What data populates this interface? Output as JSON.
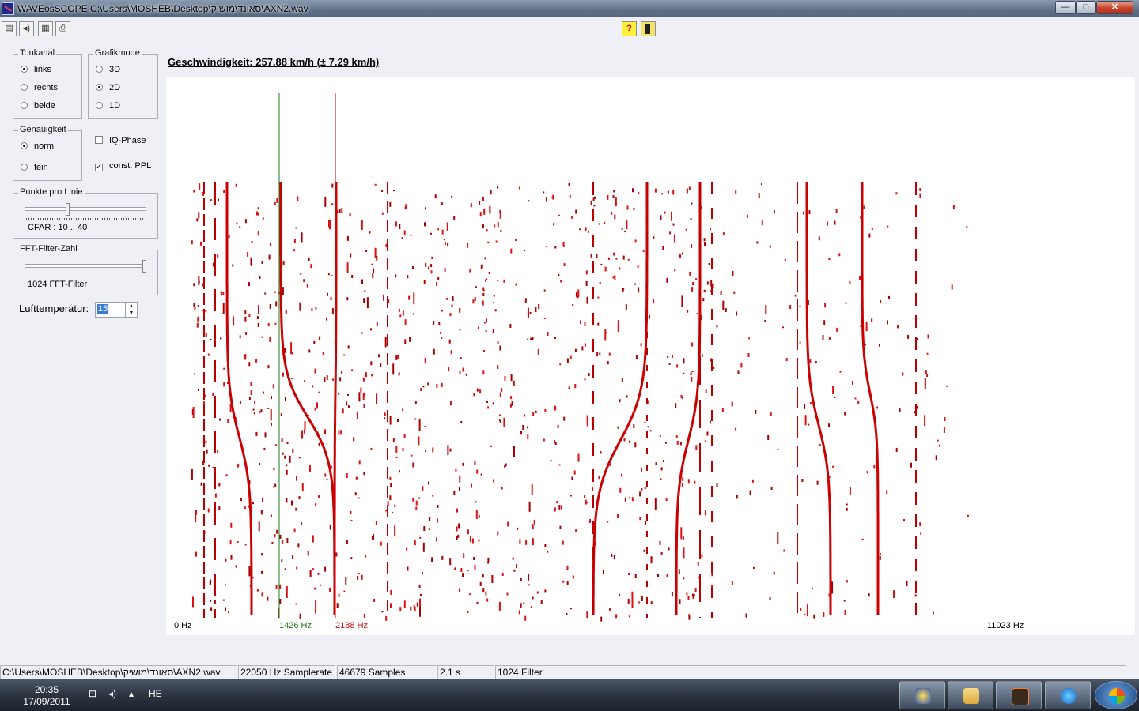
{
  "window": {
    "title": "WAVEosSCOPE  C:\\Users\\MOSHEB\\Desktop\\סאונד\\מושיק\\AXN2.wav",
    "controls": {
      "minimize": "—",
      "maximize": "□",
      "close": "✕"
    }
  },
  "toolbar": {
    "left_buttons": [
      "open-file",
      "sound",
      "chart",
      "print"
    ],
    "help_label": "?",
    "exit_icon": "door-icon"
  },
  "panels": {
    "tonkanal": {
      "label": "Tonkanal",
      "options": [
        "links",
        "rechts",
        "beide"
      ],
      "selected": "links"
    },
    "grafikmode": {
      "label": "Grafikmode",
      "options": [
        "3D",
        "2D",
        "1D"
      ],
      "selected": "2D"
    },
    "genauigkeit": {
      "label": "Genauigkeit",
      "options": [
        "norm",
        "fein"
      ],
      "selected": "norm"
    },
    "iq_phase": {
      "label": "IQ-Phase",
      "checked": false
    },
    "const_ppl": {
      "label": "const. PPL",
      "checked": true,
      "mark": "✓"
    },
    "punkte": {
      "label": "Punkte pro Linie",
      "value_text": "CFAR : 10 .. 40",
      "position": 0.35
    },
    "fft": {
      "label": "FFT-Filter-Zahl",
      "value_text": "1024 FFT-Filter",
      "position": 1.0
    },
    "temperature": {
      "label": "Lufttemperatur:",
      "value": "15",
      "up": "▲",
      "down": "▼"
    }
  },
  "speed": {
    "text": "Geschwindigkeit: 257.88 km/h (± 7.29 km/h) "
  },
  "spectrogram": {
    "freq_min_label": "0 Hz",
    "freq_max_label": "11023 Hz",
    "marker_green": {
      "label": "1426 Hz",
      "hz": 1426,
      "color": "#1a7a1a"
    },
    "marker_red": {
      "label": "2188 Hz",
      "hz": 2188,
      "color": "#cc1111"
    },
    "max_hz": 11023,
    "trace_color": "#cc0000"
  },
  "statusbar": {
    "file": "C:\\Users\\MOSHEB\\Desktop\\סאונד\\מושיק\\AXN2.wav",
    "samplerate": "22050 Hz Samplerate",
    "samples": "46679 Samples",
    "duration": "2.1 s",
    "filter": "1024 Filter"
  },
  "taskbar": {
    "time": "20:35",
    "date": "17/09/2011",
    "language": "HE",
    "tray_icons": [
      "network-icon",
      "volume-icon",
      "show-hidden-icon"
    ],
    "apps": [
      "media-app",
      "explorer-app",
      "waveoscope-app",
      "internet-explorer-app",
      "windows-start"
    ]
  }
}
